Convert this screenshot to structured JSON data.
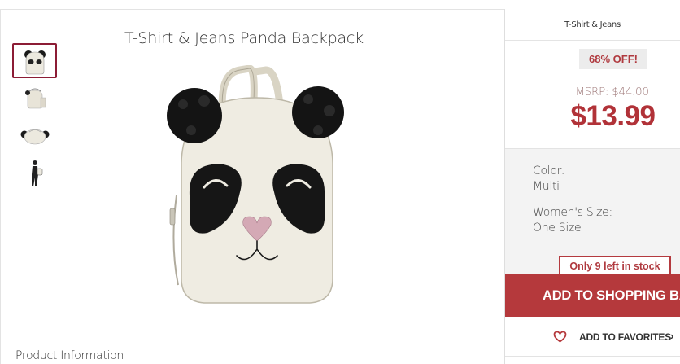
{
  "product": {
    "title": "T-Shirt & Jeans Panda Backpack",
    "section_label": "Product Information"
  },
  "thumbnails": [
    {
      "name": "front-view",
      "selected": true
    },
    {
      "name": "side-view",
      "selected": false
    },
    {
      "name": "top-view",
      "selected": false
    },
    {
      "name": "model-view",
      "selected": false
    }
  ],
  "sidebar": {
    "brand": "T-Shirt & Jeans",
    "discount": "68% OFF!",
    "msrp": "MSRP: $44.00",
    "price": "$13.99",
    "color_label": "Color:",
    "color_value": "Multi",
    "size_label": "Women's Size:",
    "size_value": "One Size",
    "stock": "Only 9 left in stock",
    "add_to_bag": "ADD TO SHOPPING BAG",
    "add_to_favorites": "ADD TO FAVORITES",
    "favorites_chevron": "›"
  },
  "colors": {
    "accent": "#b5393c",
    "selected_thumb_border": "#8c1c35",
    "options_bg": "#f3f3f3"
  },
  "icons": [
    "heart-icon",
    "chevron-right-icon"
  ]
}
